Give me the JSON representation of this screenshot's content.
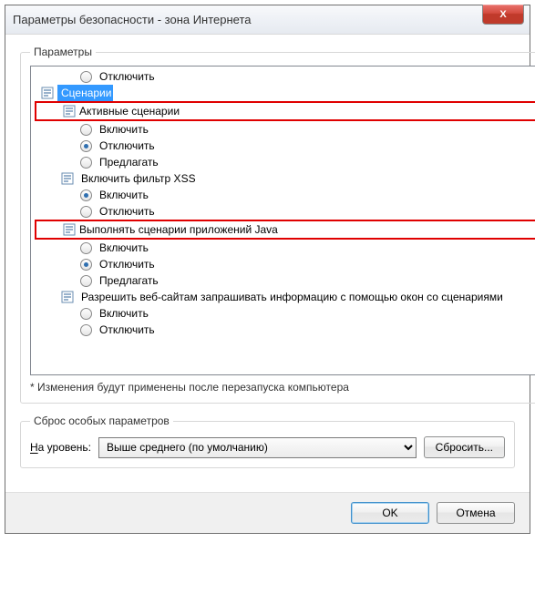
{
  "window": {
    "title": "Параметры безопасности - зона Интернета",
    "close": "X"
  },
  "groupbox": {
    "legend": "Параметры",
    "note": "* Изменения будут применены после перезапуска компьютера"
  },
  "rows": {
    "r1": "Отключить",
    "r2": "Сценарии",
    "r3": "Активные сценарии",
    "r4": "Включить",
    "r5": "Отключить",
    "r6": "Предлагать",
    "r7": "Включить фильтр XSS",
    "r8": "Включить",
    "r9": "Отключить",
    "r10": "Выполнять сценарии приложений Java",
    "r11": "Включить",
    "r12": "Отключить",
    "r13": "Предлагать",
    "r14": "Разрешить веб-сайтам запрашивать информацию с помощью окон со сценариями",
    "r15": "Включить",
    "r16": "Отключить"
  },
  "reset": {
    "legend": "Сброс особых параметров",
    "label_prefix": "Н",
    "label_rest": "а уровень:",
    "combo_value": "Выше среднего (по умолчанию)",
    "reset_btn": "Сбросить..."
  },
  "footer": {
    "ok": "OK",
    "cancel": "Отмена"
  }
}
